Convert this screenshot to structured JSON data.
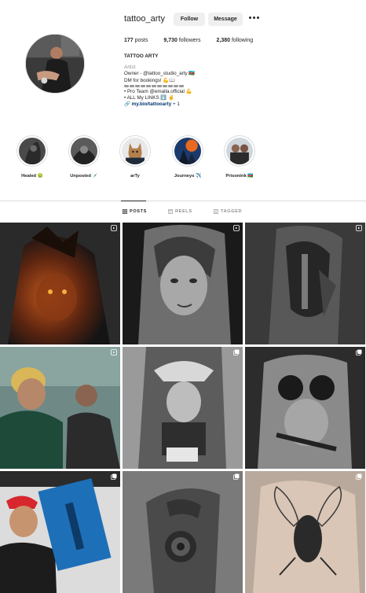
{
  "profile": {
    "username": "tattoo_arty",
    "follow_label": "Follow",
    "message_label": "Message",
    "more_icon": "more-horizontal-icon",
    "stats": {
      "posts": "177",
      "posts_label": " posts",
      "followers": "9,730",
      "followers_label": " followers",
      "following": "2,380",
      "following_label": " following"
    },
    "bio": {
      "name": "TATTOO ARTY",
      "category": "Artist",
      "line1": "Owner - @tattoo_studio_arty 🇦🇿",
      "line2": "DM for bookings! 💪📖",
      "line3": "• Pro Team @emalla.official 💪",
      "line4": "• ALL My LINKS ⬇️ ✌",
      "link_text": "my.bio/tattooarty",
      "link_plus": " + 1"
    }
  },
  "highlights": [
    {
      "label": "Healed 🤢"
    },
    {
      "label": "Unposted 💉"
    },
    {
      "label": "arTy"
    },
    {
      "label": "Journeys ✈️"
    },
    {
      "label": "Prisonink 🇦🇿"
    }
  ],
  "tabs": {
    "posts": "POSTS",
    "reels": "REELS",
    "tagged": "TAGGED",
    "active": "posts"
  },
  "posts": [
    {
      "subject": "lion sleeve",
      "type_icon": "reel-icon"
    },
    {
      "subject": "woman portrait",
      "type_icon": "reel-icon"
    },
    {
      "subject": "spartan warrior",
      "type_icon": "reel-icon"
    },
    {
      "subject": "artist tattooing",
      "type_icon": "reel-icon"
    },
    {
      "subject": "gangster bank",
      "type_icon": "carousel-icon"
    },
    {
      "subject": "woman goggles",
      "type_icon": "carousel-icon"
    },
    {
      "subject": "emalla machine promo",
      "type_icon": "carousel-icon"
    },
    {
      "subject": "rose sleeve",
      "type_icon": "carousel-icon"
    },
    {
      "subject": "beetle sketch",
      "type_icon": "carousel-icon"
    }
  ],
  "colors": {
    "text": "#262626",
    "secondary": "#8e8e8e",
    "button_bg": "#efefef",
    "border": "#dbdbdb",
    "link": "#00376b"
  }
}
